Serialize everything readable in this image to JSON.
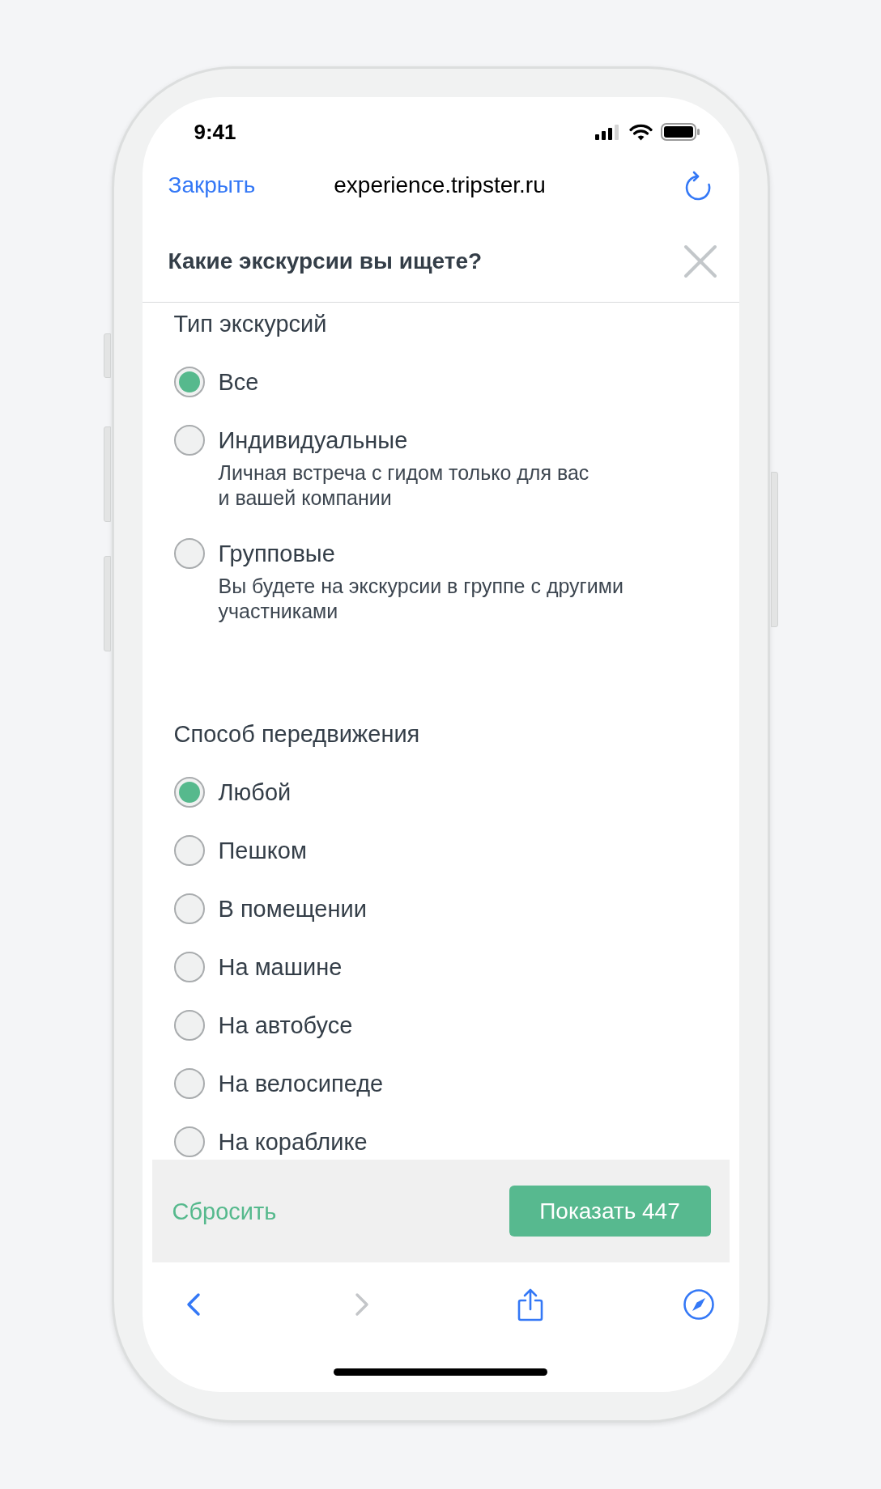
{
  "status_bar": {
    "time": "9:41"
  },
  "browser_bar": {
    "close": "Закрыть",
    "url": "experience.tripster.ru"
  },
  "dialog": {
    "title": "Какие экскурсии вы ищете?"
  },
  "sections": [
    {
      "title": "Тип экскурсий",
      "options": [
        {
          "label": "Все",
          "selected": true
        },
        {
          "label": "Индивидуальные",
          "description": "Личная встреча с гидом только для вас\nи вашей компании",
          "selected": false
        },
        {
          "label": "Групповые",
          "description": "Вы будете на экскурсии в группе с другими\nучастниками",
          "selected": false
        }
      ]
    },
    {
      "title": "Способ передвижения",
      "options": [
        {
          "label": "Любой",
          "selected": true
        },
        {
          "label": "Пешком",
          "selected": false
        },
        {
          "label": "В помещении",
          "selected": false
        },
        {
          "label": "На машине",
          "selected": false
        },
        {
          "label": "На автобусе",
          "selected": false
        },
        {
          "label": "На велосипеде",
          "selected": false
        },
        {
          "label": "На кораблике",
          "selected": false
        }
      ]
    }
  ],
  "footer": {
    "reset": "Сбросить",
    "show": "Показать 447"
  },
  "toolbar": [
    {
      "kind": "back",
      "disabled": false
    },
    {
      "kind": "forward",
      "disabled": true
    },
    {
      "kind": "share",
      "disabled": false
    },
    {
      "kind": "compass",
      "disabled": false
    }
  ]
}
